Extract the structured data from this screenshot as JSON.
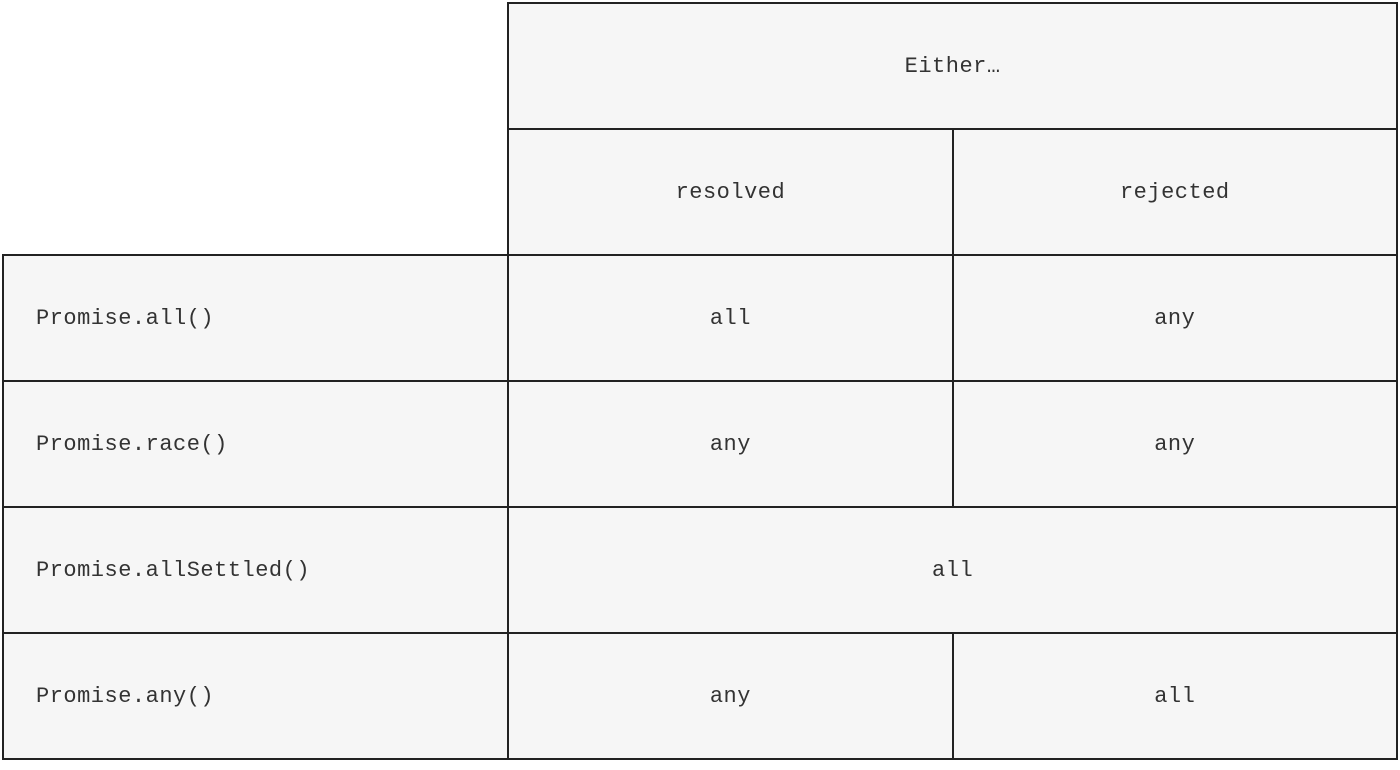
{
  "chart_data": {
    "type": "table",
    "top_header": "Either…",
    "columns": [
      "resolved",
      "rejected"
    ],
    "rows": [
      {
        "label": "Promise.all()",
        "resolved": "all",
        "rejected": "any"
      },
      {
        "label": "Promise.race()",
        "resolved": "any",
        "rejected": "any"
      },
      {
        "label": "Promise.allSettled()",
        "merged": "all"
      },
      {
        "label": "Promise.any()",
        "resolved": "any",
        "rejected": "all"
      }
    ]
  }
}
